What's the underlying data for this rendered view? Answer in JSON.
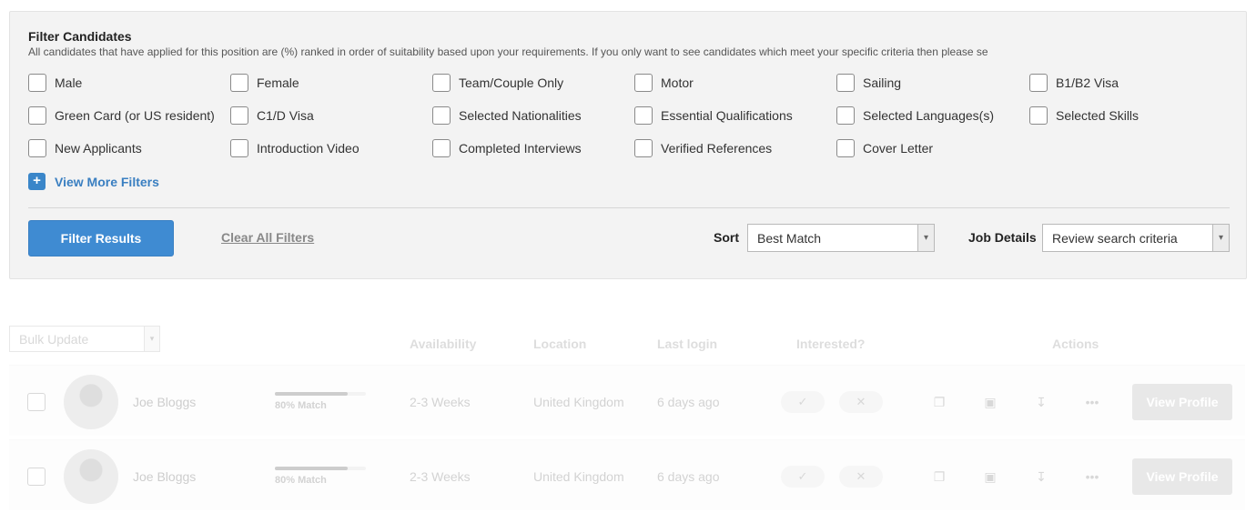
{
  "filters": {
    "title": "Filter Candidates",
    "description": "All candidates that have applied for this position are (%) ranked in order of suitability based upon your requirements. If you only want to see candidates which meet your specific criteria then please se",
    "options": [
      "Male",
      "Female",
      "Team/Couple Only",
      "Motor",
      "Sailing",
      "B1/B2 Visa",
      "Green Card (or US resident)",
      "C1/D Visa",
      "Selected Nationalities",
      "Essential Qualifications",
      "Selected Languages(s)",
      "Selected Skills",
      "New Applicants",
      "Introduction Video",
      "Completed Interviews",
      "Verified References",
      "Cover Letter"
    ],
    "more_label": "View More Filters",
    "filter_button": "Filter Results",
    "clear_link": "Clear All Filters",
    "sort_label": "Sort",
    "sort_value": "Best Match",
    "job_details_label": "Job Details",
    "job_details_value": "Review search criteria"
  },
  "table": {
    "bulk_update": "Bulk Update",
    "headers": {
      "availability": "Availability",
      "location": "Location",
      "last_login": "Last login",
      "interested": "Interested?",
      "actions": "Actions"
    },
    "rows": [
      {
        "name": "Joe Bloggs",
        "match_pct": 80,
        "match_label": "80% Match",
        "availability": "2-3 Weeks",
        "location": "United Kingdom",
        "last_login": "6 days ago",
        "button": "View Profile"
      },
      {
        "name": "Joe Bloggs",
        "match_pct": 80,
        "match_label": "80% Match",
        "availability": "2-3 Weeks",
        "location": "United Kingdom",
        "last_login": "6 days ago",
        "button": "View Profile"
      }
    ]
  },
  "icons": {
    "plus": "plus-icon",
    "check": "check-icon",
    "cross": "close-icon",
    "copy": "copy-icon",
    "video": "video-icon",
    "download": "download-icon",
    "more": "more-icon",
    "chevron": "chevron-down-icon"
  },
  "colors": {
    "primary": "#3f8bd2",
    "link": "#3a7fc1",
    "panel_bg": "#f3f3f3"
  }
}
